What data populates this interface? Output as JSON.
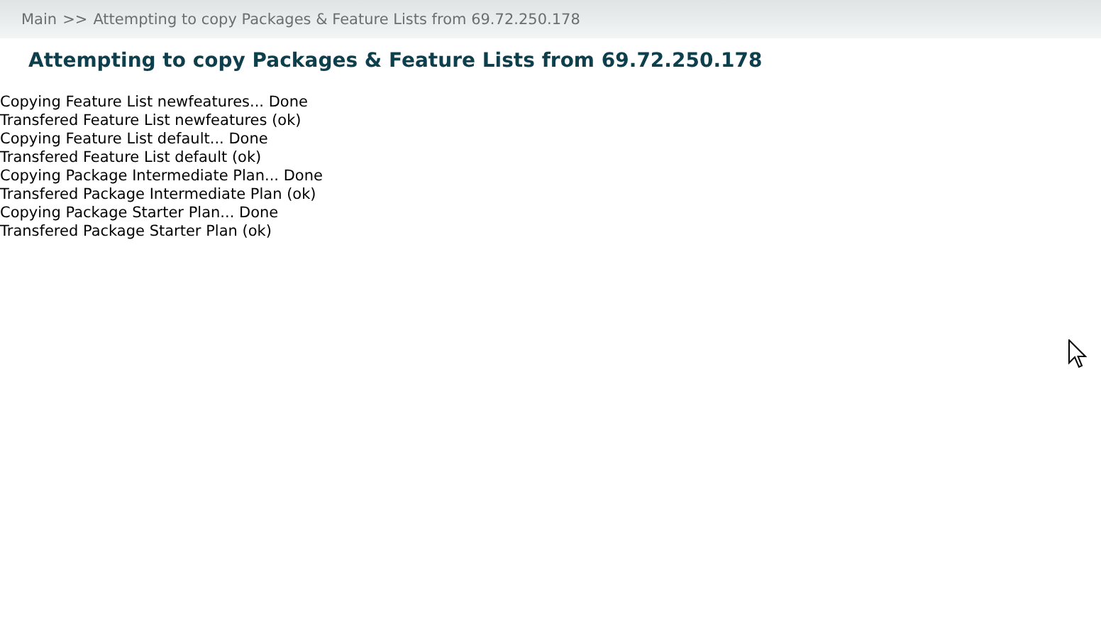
{
  "breadcrumb": {
    "link": "Main",
    "separator": ">>",
    "current": "Attempting to copy Packages & Feature Lists from 69.72.250.178"
  },
  "heading": "Attempting to copy Packages & Feature Lists from 69.72.250.178",
  "log_lines": [
    "Copying Feature List newfeatures... Done",
    "Transfered Feature List newfeatures (ok)",
    "Copying Feature List default... Done",
    "Transfered Feature List default (ok)",
    "Copying Package Intermediate Plan... Done",
    "Transfered Package Intermediate Plan (ok)",
    "Copying Package Starter Plan... Done",
    "Transfered Package Starter Plan (ok)"
  ]
}
